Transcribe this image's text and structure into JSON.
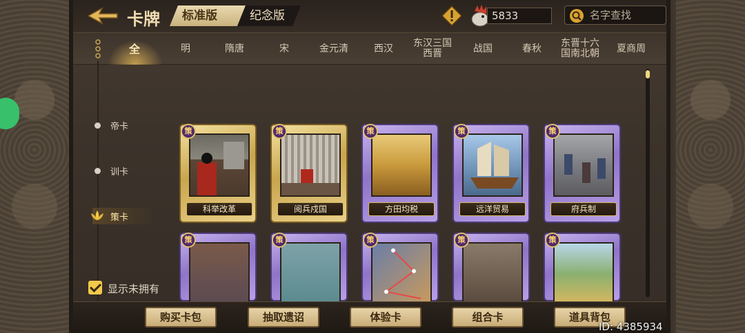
{
  "header": {
    "title": "卡牌",
    "version_tabs": [
      "标准版",
      "纪念版"
    ],
    "coins": "5833",
    "search_placeholder": "名字查找"
  },
  "eras": [
    "全",
    "明",
    "隋唐",
    "宋",
    "金元清",
    "西汉",
    "东汉三国\n西晋",
    "战国",
    "春秋",
    "东晋十六\n国南北朝",
    "夏商周"
  ],
  "ranks": [
    "帝卡",
    "训卡",
    "策卡"
  ],
  "cards_row1": [
    {
      "badge": "策",
      "name": "科举改革"
    },
    {
      "badge": "策",
      "name": "阅兵戍国"
    },
    {
      "badge": "策",
      "name": "方田均税"
    },
    {
      "badge": "策",
      "name": "远洋贸易"
    },
    {
      "badge": "策",
      "name": "府兵制"
    }
  ],
  "cards_row2": [
    {
      "badge": "策"
    },
    {
      "badge": "策"
    },
    {
      "badge": "策"
    },
    {
      "badge": "策"
    },
    {
      "badge": "策"
    }
  ],
  "show_unowned": "显示未拥有",
  "buttons": [
    "购买卡包",
    "抽取遗诏",
    "体验卡",
    "组合卡",
    "道具背包"
  ],
  "id_label": "ID: 4385934",
  "colors": {
    "accent_gold": "#f2c94a",
    "card_gold": "#c9a64e",
    "card_purple": "#8f74c8"
  }
}
